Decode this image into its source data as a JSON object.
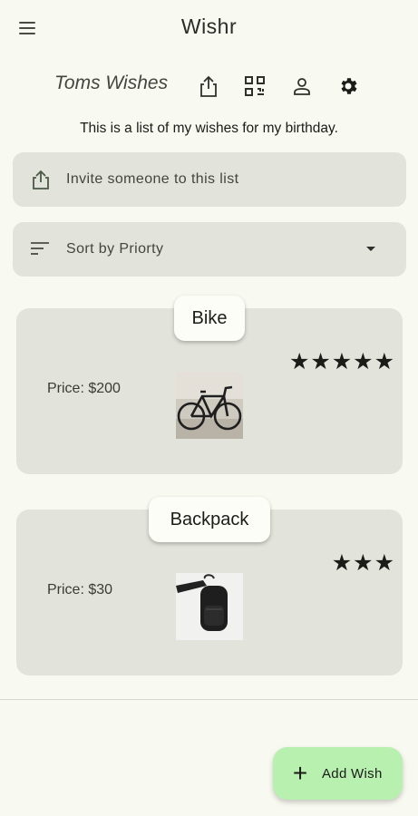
{
  "app": {
    "title": "Wishr"
  },
  "header": {
    "list_title": "Toms Wishes",
    "actions": [
      "share-icon",
      "qr-code-icon",
      "person-icon",
      "settings-icon"
    ]
  },
  "description": "This is a list of my wishes for my birthday.",
  "invite": {
    "label": "Invite someone to this list",
    "icon": "share-icon"
  },
  "sort": {
    "label": "Sort by Priorty",
    "icon": "sort-icon"
  },
  "wishes": [
    {
      "name": "Bike",
      "price": "Price: $200",
      "stars": "★★★★★",
      "rating": 5,
      "image": "bicycle photo"
    },
    {
      "name": "Backpack",
      "price": "Price: $30",
      "stars": "★★★",
      "rating": 3,
      "image": "backpack photo"
    }
  ],
  "fab": {
    "label": "Add Wish",
    "icon": "plus-icon"
  },
  "colors": {
    "background": "#f8f9f1",
    "surface": "#e2e3da",
    "fab": "#b8f0b0"
  }
}
